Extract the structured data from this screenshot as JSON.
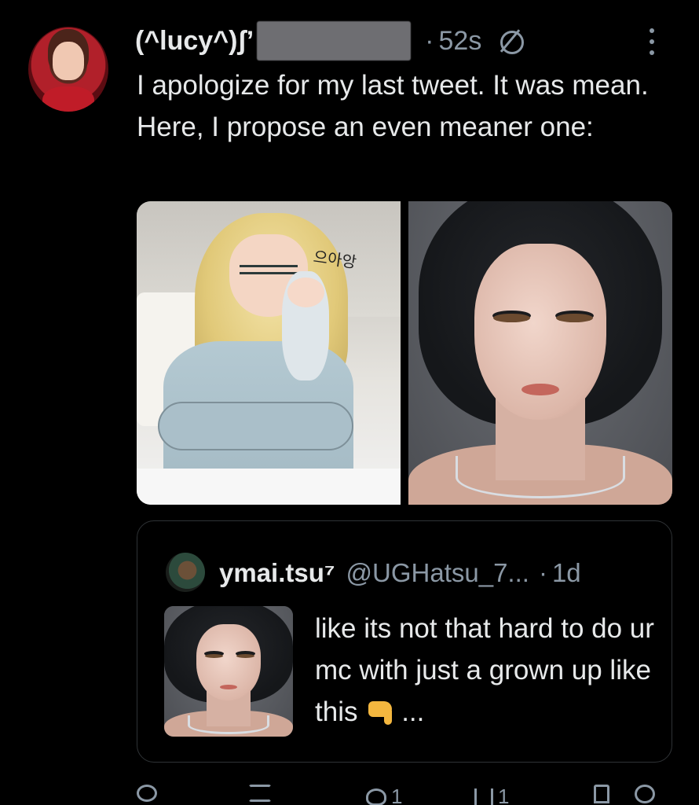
{
  "tweet": {
    "author_name": "(^lucy^)ʃ’",
    "time": "52s",
    "separator": "·",
    "text": "I apologize for my last tweet. It was mean. Here, I propose an even meaner one:"
  },
  "media": {
    "left_image_sfx": "으아앙"
  },
  "quote": {
    "name": "ymai.tsu⁷",
    "handle": "@UGHatsu_7...",
    "separator": "·",
    "time": "1d",
    "text_before_emoji": "like its not that hard to do ur mc with just a grown up like this",
    "text_after_emoji": "..."
  },
  "actions": {
    "likes": "1",
    "views": "1"
  }
}
